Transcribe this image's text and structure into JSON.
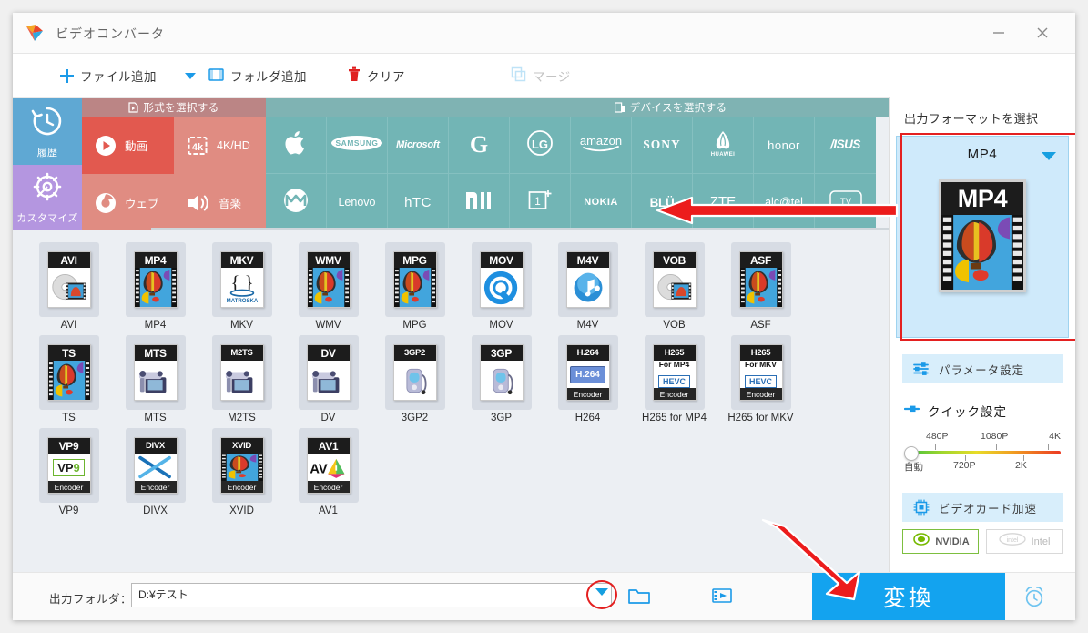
{
  "window": {
    "title": "ビデオコンバータ",
    "minimize_label": "−",
    "close_label": "×"
  },
  "toolbar": {
    "add_file": "ファイル追加",
    "add_folder": "フォルダ追加",
    "clear": "クリア",
    "merge": "マージ"
  },
  "side_tabs": [
    {
      "label": "履歴",
      "icon": "history-icon",
      "color": "#5fa8d3"
    },
    {
      "label": "カスタマイズ",
      "icon": "gear-icon",
      "color": "#b496e0"
    }
  ],
  "category": {
    "format_header": "形式を選択する",
    "device_header": "デバイスを選択する",
    "format_cells": [
      {
        "label": "動画",
        "icon": "play-circle-icon",
        "selected": true
      },
      {
        "label": "4K/HD",
        "icon": "4k-icon",
        "selected": false
      },
      {
        "label": "ウェブ",
        "icon": "chrome-icon",
        "selected": false
      },
      {
        "label": "音楽",
        "icon": "speaker-icon",
        "selected": false
      }
    ],
    "device_row1": [
      "Apple",
      "SAMSUNG",
      "Microsoft",
      "G",
      "LG",
      "amazon",
      "SONY",
      "HUAWEI",
      "honor",
      "ASUS"
    ],
    "device_row2": [
      "Motorola",
      "Lenovo",
      "HTC",
      "MI",
      "OnePlus",
      "NOKIA",
      "BLU",
      "ZTE",
      "alcatel",
      "TV"
    ]
  },
  "formats": [
    {
      "name": "AVI",
      "badge": "AVI",
      "art": "disc-film",
      "encoder": ""
    },
    {
      "name": "MP4",
      "badge": "MP4",
      "art": "balloon",
      "encoder": ""
    },
    {
      "name": "MKV",
      "badge": "MKV",
      "art": "matroska",
      "encoder": ""
    },
    {
      "name": "WMV",
      "badge": "WMV",
      "art": "balloon",
      "encoder": ""
    },
    {
      "name": "MPG",
      "badge": "MPG",
      "art": "balloon",
      "encoder": ""
    },
    {
      "name": "MOV",
      "badge": "MOV",
      "art": "quicktime",
      "encoder": ""
    },
    {
      "name": "M4V",
      "badge": "M4V",
      "art": "itunes",
      "encoder": ""
    },
    {
      "name": "VOB",
      "badge": "VOB",
      "art": "disc-film",
      "encoder": ""
    },
    {
      "name": "ASF",
      "badge": "ASF",
      "art": "balloon",
      "encoder": ""
    },
    {
      "name": "TS",
      "badge": "TS",
      "art": "balloon",
      "encoder": ""
    },
    {
      "name": "MTS",
      "badge": "MTS",
      "art": "camcorder",
      "encoder": ""
    },
    {
      "name": "M2TS",
      "badge": "M2TS",
      "art": "camcorder",
      "encoder": ""
    },
    {
      "name": "DV",
      "badge": "DV",
      "art": "camcorder",
      "encoder": ""
    },
    {
      "name": "3GP2",
      "badge": "3GP2",
      "art": "phone",
      "encoder": ""
    },
    {
      "name": "3GP",
      "badge": "3GP",
      "art": "phone",
      "encoder": ""
    },
    {
      "name": "H264",
      "badge": "H.264",
      "art": "h264",
      "encoder": "Encoder"
    },
    {
      "name": "H265 for MP4",
      "badge": "H265",
      "art": "hevc",
      "encoder": "Encoder",
      "sub": "For MP4"
    },
    {
      "name": "H265 for MKV",
      "badge": "H265",
      "art": "hevc",
      "encoder": "Encoder",
      "sub": "For MKV"
    },
    {
      "name": "VP9",
      "badge": "VP9",
      "art": "vp9",
      "encoder": "Encoder"
    },
    {
      "name": "DIVX",
      "badge": "DIVX",
      "art": "divx",
      "encoder": "Encoder"
    },
    {
      "name": "XVID",
      "badge": "XVID",
      "art": "balloon",
      "encoder": "Encoder"
    },
    {
      "name": "AV1",
      "badge": "AV1",
      "art": "av1",
      "encoder": "Encoder"
    }
  ],
  "right_panel": {
    "title": "出力フォーマットを選択",
    "selected_format": "MP4",
    "param_button": "パラメータ設定",
    "quick_title": "クイック設定",
    "slider": {
      "top_labels": [
        "480P",
        "1080P",
        "4K"
      ],
      "bottom_labels": [
        "自動",
        "720P",
        "2K"
      ],
      "value": "自動"
    },
    "gpu_button": "ビデオカード加速",
    "gpu_chips": [
      {
        "label": "NVIDIA",
        "active": true
      },
      {
        "label": "Intel",
        "active": false
      }
    ]
  },
  "bottom": {
    "output_label": "出力フォルダ：",
    "output_path": "D:¥テスト",
    "convert_label": "変換",
    "folder_icon": "open-folder-icon",
    "media_icon": "media-folder-icon",
    "alarm_icon": "alarm-clock-icon"
  },
  "colors": {
    "accent_blue": "#13a3ef",
    "tab_red_selected": "#e2594f",
    "tab_red": "#e08c82",
    "device_teal": "#72b5b5",
    "annotation_red": "#e42020"
  }
}
